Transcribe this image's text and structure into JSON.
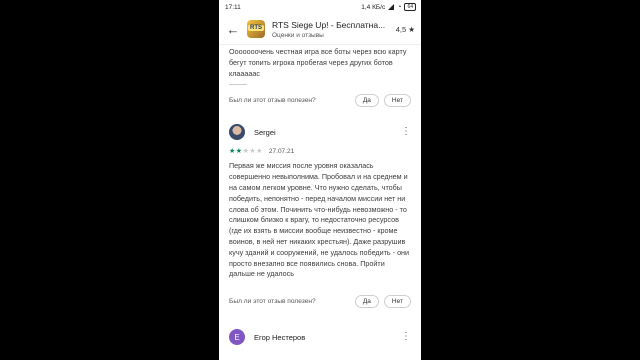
{
  "status_bar": {
    "time": "17:11",
    "network": "1,4 КБ/с",
    "battery": "64"
  },
  "header": {
    "app_title": "RTS Siege Up! - Бесплатна...",
    "subtitle": "Оценки и отзывы",
    "rating": "4,5 ★",
    "icon_text": "RTS"
  },
  "reviews": [
    {
      "text": "Ооооооочень честная игра все боты через всю карту бегут топить игрока пробегая через других ботов клааааас",
      "helpful_question": "Был ли этот отзыв полезен?",
      "yes_label": "Да",
      "no_label": "Нет"
    },
    {
      "name": "Sergei",
      "stars": 2,
      "max_stars": 5,
      "date": "27.07.21",
      "text": "Первая же миссия после уровня оказалась совершенно невыполнима. Пробовал и на среднем и на самом легком уровне. Что нужно сделать, чтобы победить, непонятно - перед началом миссии нет ни слова об этом. Починить что-нибудь невозможно - то слишком близко к врагу, то недостаточно ресурсов (где их взять в миссии вообще неизвестно - кроме воинов, в ней нет никаких крестьян). Даже разрушив кучу зданий и сооружений, не удалось победить - они просто внезапно все появились снова. Пройти дальше не удалось",
      "helpful_question": "Был ли этот отзыв полезен?",
      "yes_label": "Да",
      "no_label": "Нет"
    },
    {
      "name": "Егор Нестеров",
      "avatar_letter": "Е"
    }
  ],
  "colors": {
    "star_filled": "#01875f",
    "star_empty": "#c9c9c9",
    "avatar_letter_bg": "#7e57c2"
  }
}
